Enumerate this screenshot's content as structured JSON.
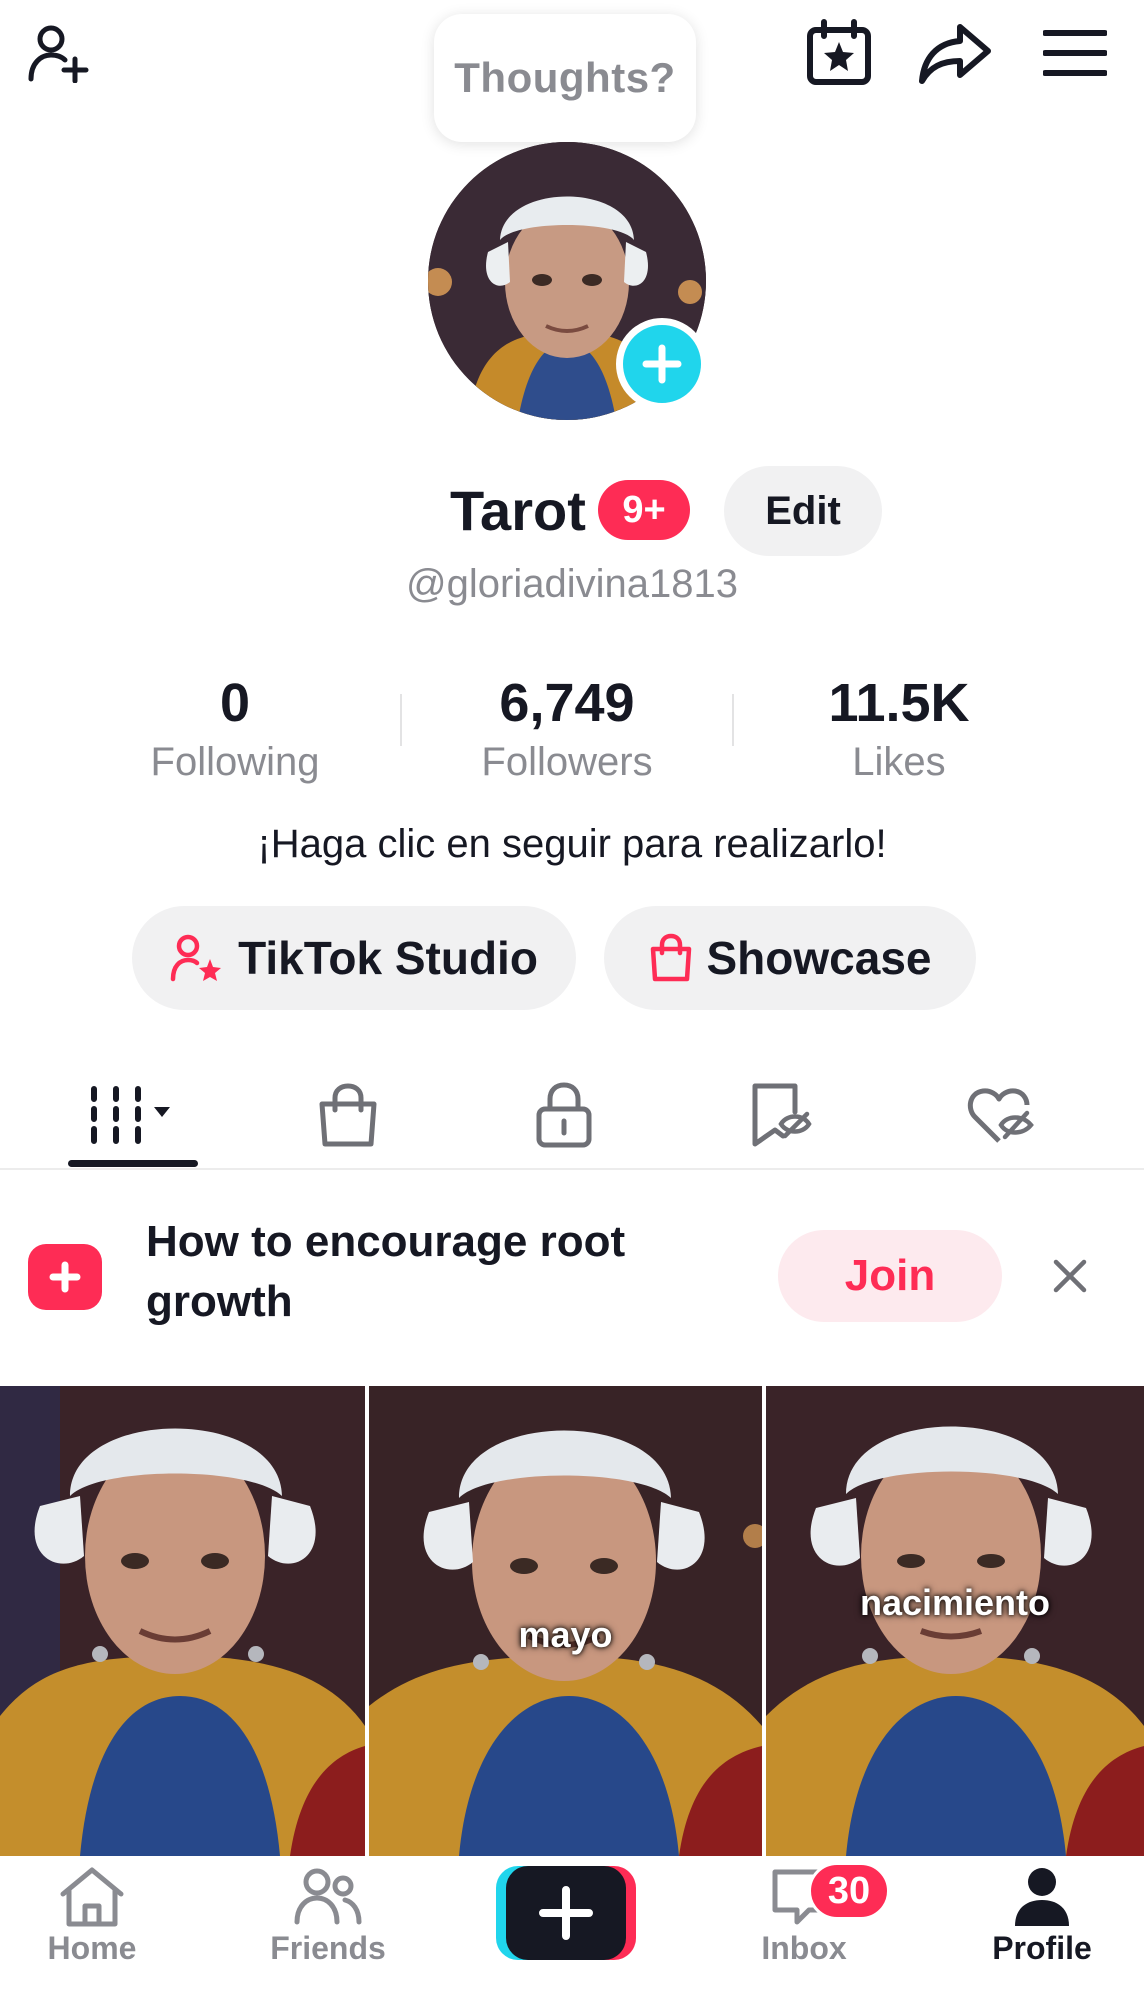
{
  "thoughts_bubble": {
    "text": "Thoughts?"
  },
  "profile": {
    "display_name": "Tarot",
    "notification_badge": "9+",
    "edit_label": "Edit",
    "username": "@gloriadivina1813",
    "bio": "¡Haga clic en seguir para realizarlo!"
  },
  "stats": {
    "following": {
      "value": "0",
      "label": "Following"
    },
    "followers": {
      "value": "6,749",
      "label": "Followers"
    },
    "likes": {
      "value": "11.5K",
      "label": "Likes"
    }
  },
  "actions": {
    "studio_label": "TikTok Studio",
    "showcase_label": "Showcase"
  },
  "tabs": [
    {
      "name": "videos",
      "icon": "grid-icon"
    },
    {
      "name": "shop",
      "icon": "shopping-bag-icon"
    },
    {
      "name": "private",
      "icon": "lock-icon"
    },
    {
      "name": "favorites",
      "icon": "bookmark-hidden-icon"
    },
    {
      "name": "liked",
      "icon": "heart-hidden-icon"
    }
  ],
  "banner": {
    "text": "How to encourage root growth",
    "join_label": "Join"
  },
  "videos": [
    {
      "caption": ""
    },
    {
      "caption": "mayo"
    },
    {
      "caption": "nacimiento"
    }
  ],
  "bottom_nav": {
    "home": "Home",
    "friends": "Friends",
    "inbox": "Inbox",
    "inbox_badge": "30",
    "profile": "Profile"
  },
  "colors": {
    "accent": "#fe2c55",
    "cyan": "#20d5ec",
    "text": "#161823",
    "muted": "#8a8b91",
    "pill_bg": "#f1f1f2"
  }
}
